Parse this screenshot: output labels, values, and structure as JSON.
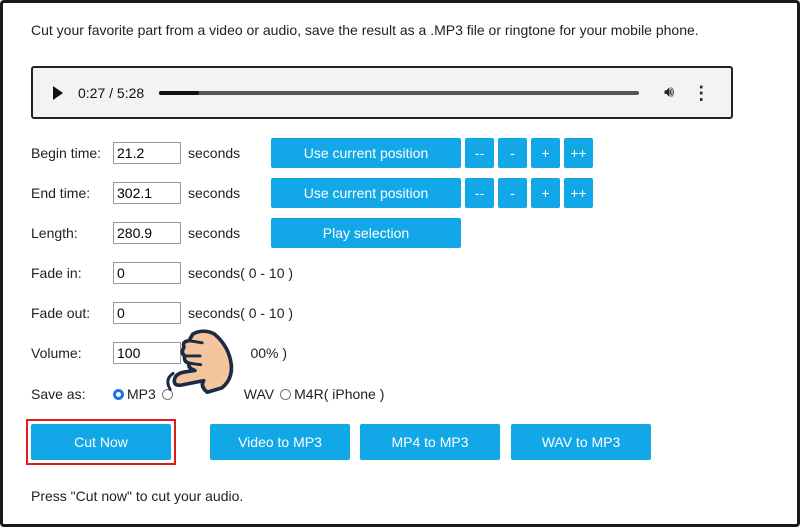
{
  "intro": "Cut your favorite part from a video or audio, save the result as a .MP3 file or ringtone for your mobile phone.",
  "player": {
    "time": "0:27 / 5:28",
    "progress_fraction": 0.082
  },
  "rows": {
    "begin": {
      "label": "Begin time:",
      "value": "21.2",
      "unit": "seconds",
      "use_btn": "Use current position"
    },
    "end": {
      "label": "End time:",
      "value": "302.1",
      "unit": "seconds",
      "use_btn": "Use current position"
    },
    "length": {
      "label": "Length:",
      "value": "280.9",
      "unit": "seconds",
      "play_btn": "Play selection"
    },
    "fade_in": {
      "label": "Fade in:",
      "value": "0",
      "unit": "seconds( 0 - 10 )"
    },
    "fade_out": {
      "label": "Fade out:",
      "value": "0",
      "unit": "seconds( 0 - 10 )"
    },
    "volume": {
      "label": "Volume:",
      "value": "100",
      "unit": "%",
      "unit_tail": "00% )"
    }
  },
  "step_buttons": {
    "minus2": "--",
    "minus": "-",
    "plus": "+",
    "plus2": "++"
  },
  "save_as": {
    "label": "Save as:",
    "options": [
      "MP3",
      "",
      "WAV",
      "M4R( iPhone )"
    ],
    "selected": "MP3"
  },
  "buttons": {
    "cut": "Cut Now",
    "video": "Video to MP3",
    "mp4": "MP4 to MP3",
    "wav": "WAV to MP3"
  },
  "status": "Press \"Cut now\" to cut your audio.",
  "colors": {
    "button": "#12a8e8",
    "highlight": "#e01b1b"
  }
}
